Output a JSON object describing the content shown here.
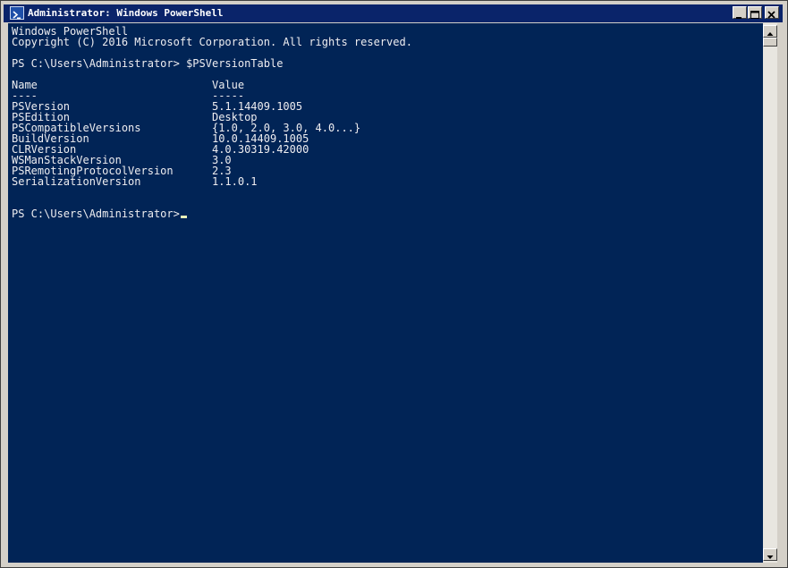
{
  "window": {
    "title": "Administrator: Windows PowerShell"
  },
  "console": {
    "lines": [
      "Windows PowerShell",
      "Copyright (C) 2016 Microsoft Corporation. All rights reserved.",
      "",
      "PS C:\\Users\\Administrator> $PSVersionTable",
      "",
      "Name                           Value",
      "----                           -----",
      "PSVersion                      5.1.14409.1005",
      "PSEdition                      Desktop",
      "PSCompatibleVersions           {1.0, 2.0, 3.0, 4.0...}",
      "BuildVersion                   10.0.14409.1005",
      "CLRVersion                     4.0.30319.42000",
      "WSManStackVersion              3.0",
      "PSRemotingProtocolVersion      2.3",
      "SerializationVersion           1.1.0.1",
      "",
      "",
      "PS C:\\Users\\Administrator> "
    ]
  },
  "icons": {
    "app": "powershell-icon",
    "minimize": "minimize-icon",
    "maximize": "maximize-icon",
    "close": "close-icon",
    "scroll_up": "arrow-up-icon",
    "scroll_down": "arrow-down-icon"
  },
  "colors": {
    "console_bg": "#012456",
    "console_text": "#eeedf0",
    "titlebar": "#0a246a"
  }
}
